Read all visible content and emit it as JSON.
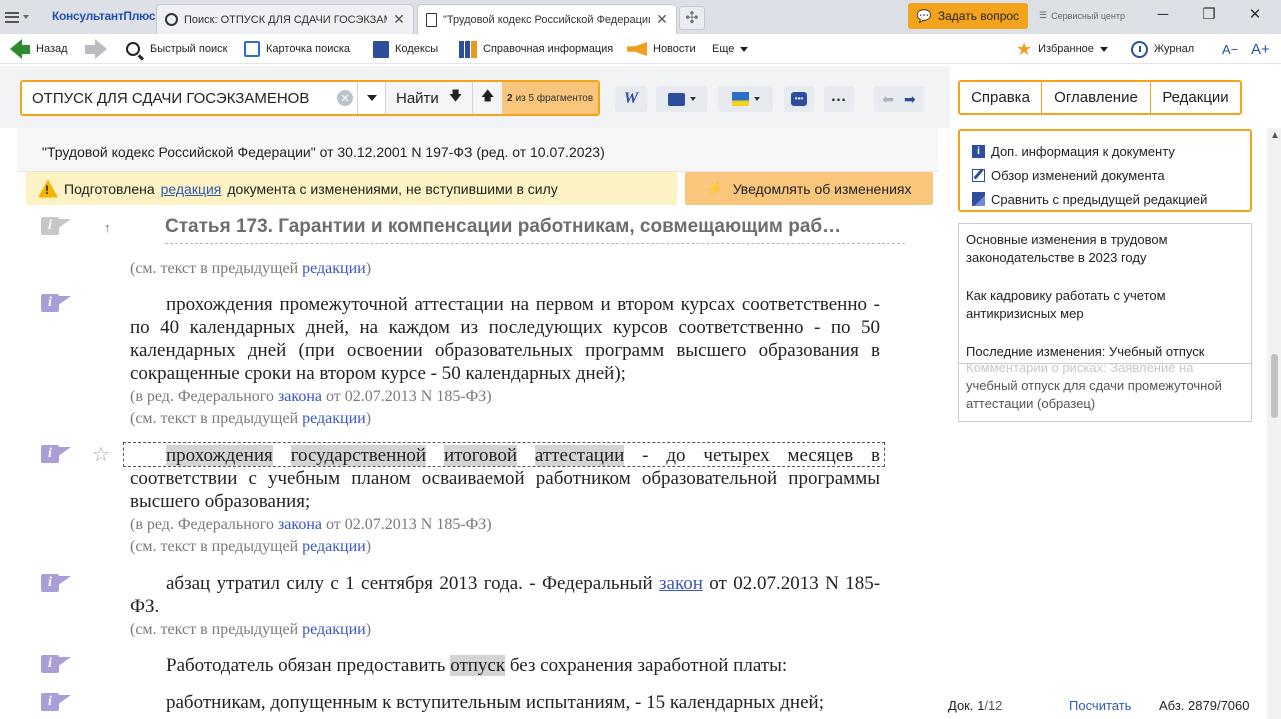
{
  "tabs": {
    "logo": "КонсультантПлюс",
    "items": [
      {
        "label": "Поиск: ОТПУСК ДЛЯ СДАЧИ ГОСЭКЗАМЕНОВ"
      },
      {
        "label": "\"Трудовой кодекс Российской Федерации\""
      }
    ],
    "ask": "Задать вопрос",
    "service": "Сервисный центр"
  },
  "toolbar": {
    "back": "Назад",
    "quick_search": "Быстрый поиск",
    "search_card": "Карточка поиска",
    "codes": "Кодексы",
    "reference": "Справочная информация",
    "news": "Новости",
    "more": "Еще",
    "favorites": "Избранное",
    "journal": "Журнал",
    "font_minus": "A−",
    "font_plus": "A+"
  },
  "search": {
    "value": "ОТПУСК ДЛЯ СДАЧИ ГОСЭКЗАМЕНОВ",
    "find": "Найти",
    "fragments_num": "2",
    "fragments_text": "из 5 фрагментов"
  },
  "document": {
    "title": "\"Трудовой кодекс Российской Федерации\" от 30.12.2001 N 197-ФЗ (ред. от 10.07.2023)",
    "notice_pre": "Подготовлена",
    "notice_link": "редакция",
    "notice_post": "документа с изменениями, не вступившими в силу",
    "notify": "Уведомлять об изменениях",
    "article_title": "Статья 173. Гарантии и компенсации работникам, совмещающим раб…",
    "see_prev": "(см. текст в предыдущей",
    "see_prev_link": "редакции",
    "red_prefix": "(в ред. Федерального",
    "red_link": "закона",
    "red_suffix": "от 02.07.2013 N 185-ФЗ)",
    "para1": "прохождения промежуточной аттестации на первом и втором курсах соответственно - по 40 календарных дней, на каждом из последующих курсов соответственно - по 50 календарных дней (при освоении образовательных программ высшего образования в сокращенные сроки на втором курсе - 50 календарных дней);",
    "para2_words": [
      "прохождения",
      "государственной",
      "итоговой",
      "аттестации"
    ],
    "para2_rest": "- до четырех месяцев в соответствии с учебным планом осваиваемой работником образовательной программы высшего образования;",
    "para3_pre": "абзац утратил силу с 1 сентября 2013 года. - Федеральный",
    "para3_link": "закон",
    "para3_post": "от 02.07.2013 N 185-ФЗ.",
    "para4_pre": "Работодатель обязан предоставить",
    "para4_mark": "отпуск",
    "para4_post": "без сохранения заработной платы:",
    "para5": "работникам, допущенным к вступительным испытаниям, - 15 календарных дней;"
  },
  "right_panel": {
    "tabs": [
      "Справка",
      "Оглавление",
      "Редакции"
    ],
    "info": [
      "Доп. информация к документу",
      "Обзор изменений документа",
      "Сравнить с предыдущей редакцией"
    ],
    "news": [
      "Основные изменения в трудовом законодательстве в 2023 году",
      "Как кадровику работать с учетом антикризисных мер",
      "Последние изменения: Учебный отпуск"
    ],
    "news_faded_ghost": "Комментарии о рисках: Заявление на",
    "news_faded": "учебный отпуск для сдачи промежуточной аттестации (образец)"
  },
  "status": {
    "doc_label": "Док.",
    "doc_num": "1",
    "doc_total": "/12",
    "count": "Посчитать",
    "abz_label": "Абз.",
    "abz_num": "2879",
    "abz_total": "/7060"
  }
}
